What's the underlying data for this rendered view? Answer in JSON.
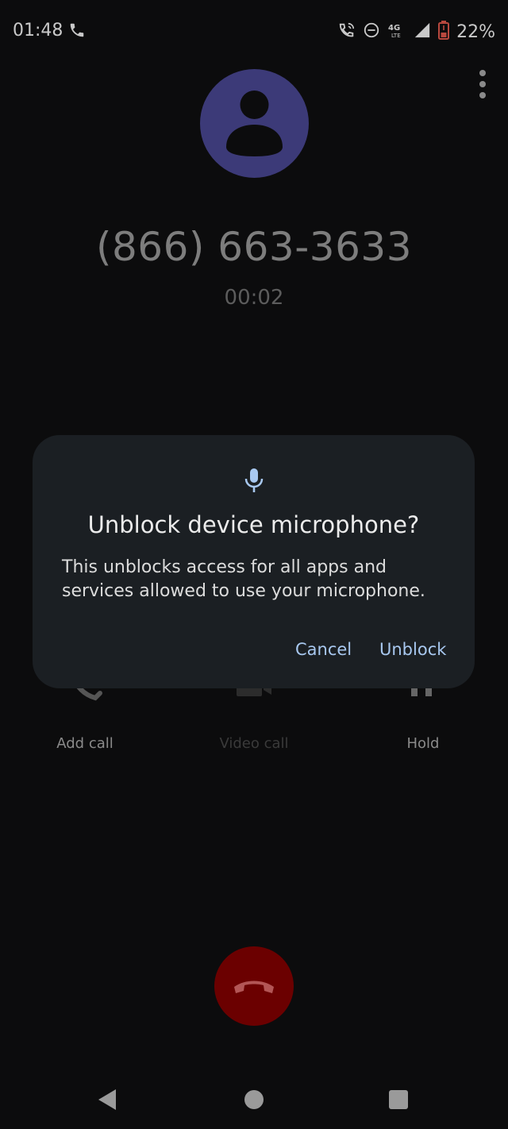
{
  "status_bar": {
    "time": "01:48",
    "battery": "22%",
    "icons": [
      "phone-icon",
      "wifi-call-icon",
      "do-not-disturb-icon",
      "4g-lte-icon",
      "signal-icon",
      "battery-icon"
    ]
  },
  "call": {
    "number": "(866) 663-3633",
    "timer": "00:02"
  },
  "controls": {
    "add_call": "Add call",
    "video_call": "Video call",
    "hold": "Hold"
  },
  "dialog": {
    "title": "Unblock device microphone?",
    "body": "This unblocks access for all apps and services allowed to use your microphone.",
    "cancel": "Cancel",
    "unblock": "Unblock"
  },
  "colors": {
    "background": "#0c0c0d",
    "dialog": "#1b1f23",
    "accent": "#a8c8f0",
    "avatar": "#3c3a78",
    "end_call": "#6b0000"
  }
}
